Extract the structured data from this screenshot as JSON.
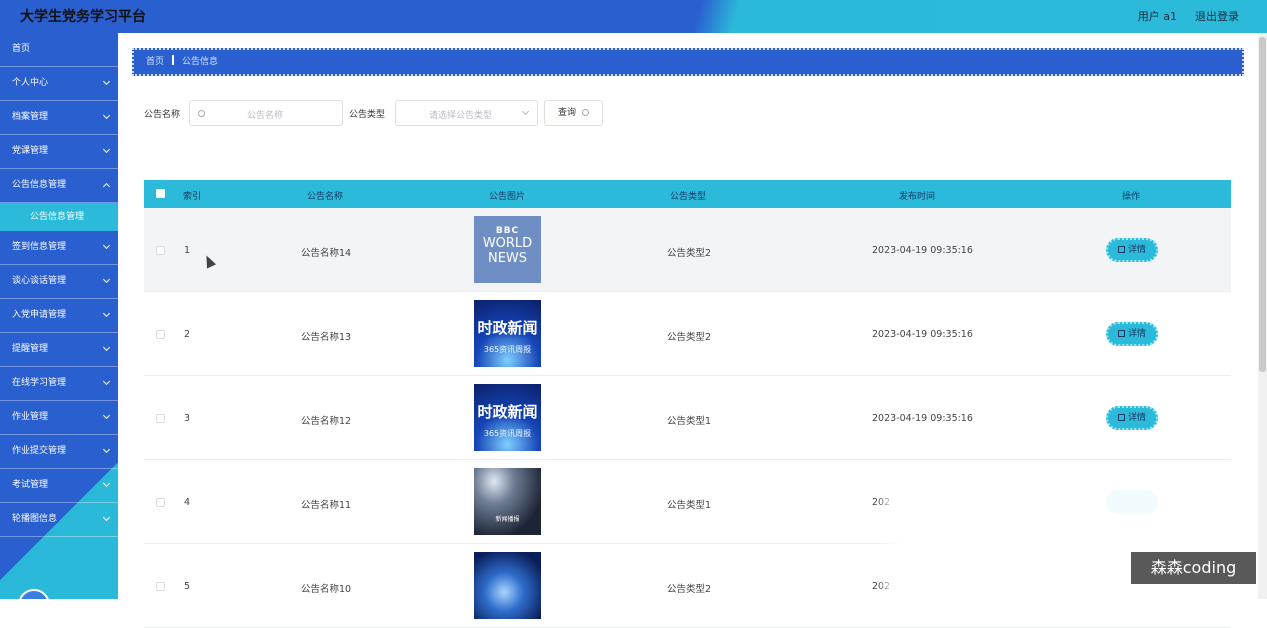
{
  "header": {
    "title": "大学生党务学习平台",
    "user": "用户 a1",
    "logout": "退出登录"
  },
  "sidebar": {
    "items": [
      {
        "label": "首页",
        "chevron": false
      },
      {
        "label": "个人中心",
        "chevron": true
      },
      {
        "label": "档案管理",
        "chevron": true
      },
      {
        "label": "党课管理",
        "chevron": true
      },
      {
        "label": "公告信息管理",
        "chevron": true
      },
      {
        "label": "签到信息管理",
        "chevron": true
      },
      {
        "label": "谈心谈话管理",
        "chevron": true
      },
      {
        "label": "入党申请管理",
        "chevron": true
      },
      {
        "label": "提醒管理",
        "chevron": true
      },
      {
        "label": "在线学习管理",
        "chevron": true
      },
      {
        "label": "作业管理",
        "chevron": true
      },
      {
        "label": "作业提交管理",
        "chevron": true
      },
      {
        "label": "考试管理",
        "chevron": true
      },
      {
        "label": "轮播图信息",
        "chevron": true
      }
    ],
    "sub_item": "公告信息管理"
  },
  "breadcrumb": {
    "home": "首页",
    "current": "公告信息"
  },
  "search": {
    "name_label": "公告名称",
    "name_placeholder": "公告名称",
    "type_label": "公告类型",
    "type_placeholder": "请选择公告类型",
    "query_button": "查询"
  },
  "table": {
    "headers": {
      "index": "索引",
      "name": "公告名称",
      "image": "公告图片",
      "type": "公告类型",
      "time": "发布时间",
      "action": "操作"
    },
    "detail_label": "详情",
    "rows": [
      {
        "index": "1",
        "name": "公告名称14",
        "image": "bbc",
        "image_text": [
          "BBC",
          "WORLD",
          "NEWS"
        ],
        "type": "公告类型2",
        "time": "2023-04-19 09:35:16"
      },
      {
        "index": "2",
        "name": "公告名称13",
        "image": "news",
        "image_text": [
          "时政新闻",
          "365资讯周报"
        ],
        "type": "公告类型2",
        "time": "2023-04-19 09:35:16"
      },
      {
        "index": "3",
        "name": "公告名称12",
        "image": "news",
        "image_text": [
          "时政新闻",
          "365资讯周报"
        ],
        "type": "公告类型1",
        "time": "2023-04-19 09:35:16"
      },
      {
        "index": "4",
        "name": "公告名称11",
        "image": "stage",
        "image_text": [
          "新闻播报"
        ],
        "type": "公告类型1",
        "time": "202"
      },
      {
        "index": "5",
        "name": "公告名称10",
        "image": "globe",
        "image_text": [],
        "type": "公告类型2",
        "time": "202"
      }
    ]
  },
  "watermark": "森森coding",
  "colors": {
    "primary": "#2a5fd0",
    "accent": "#2bbad9"
  }
}
